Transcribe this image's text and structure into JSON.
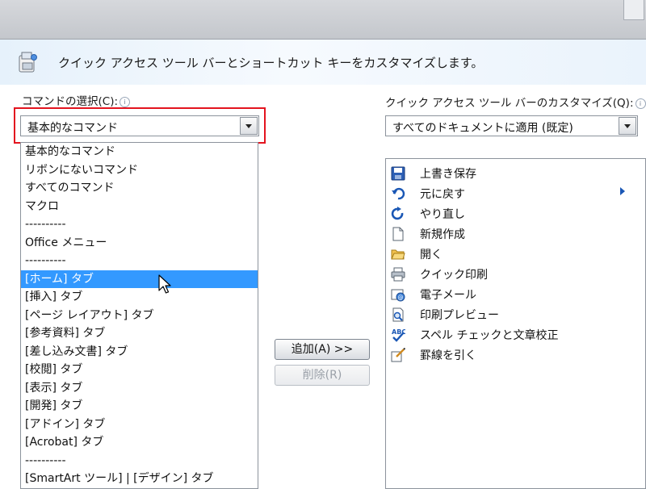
{
  "header": {
    "description": "クイック アクセス ツール バーとショートカット キーをカスタマイズします。"
  },
  "left": {
    "label": "コマンドの選択(C):",
    "selected_value": "基本的なコマンド",
    "options": [
      "基本的なコマンド",
      "リボンにないコマンド",
      "すべてのコマンド",
      "マクロ",
      "----------",
      "Office メニュー",
      "----------",
      "[ホーム] タブ",
      "[挿入] タブ",
      "[ページ レイアウト] タブ",
      "[参考資料] タブ",
      "[差し込み文書] タブ",
      "[校閲] タブ",
      "[表示] タブ",
      "[開発] タブ",
      "[アドイン] タブ",
      "[Acrobat] タブ",
      "----------",
      "[SmartArt ツール] | [デザイン] タブ"
    ],
    "highlighted_option": "[ホーム] タブ"
  },
  "middle": {
    "add_button": "追加(A) >>",
    "remove_button": "削除(R)"
  },
  "right": {
    "label": "クイック アクセス ツール バーのカスタマイズ(Q):",
    "scope_value": "すべてのドキュメントに適用 (既定)",
    "items": [
      {
        "label": "上書き保存",
        "icon": "save-icon"
      },
      {
        "label": "元に戻す",
        "icon": "undo-icon"
      },
      {
        "label": "やり直し",
        "icon": "redo-icon"
      },
      {
        "label": "新規作成",
        "icon": "new-document-icon"
      },
      {
        "label": "開く",
        "icon": "open-folder-icon"
      },
      {
        "label": "クイック印刷",
        "icon": "quick-print-icon"
      },
      {
        "label": "電子メール",
        "icon": "email-icon"
      },
      {
        "label": "印刷プレビュー",
        "icon": "print-preview-icon"
      },
      {
        "label": "スペル チェックと文章校正",
        "icon": "spell-check-icon"
      },
      {
        "label": "罫線を引く",
        "icon": "draw-border-icon"
      }
    ]
  },
  "colors": {
    "highlight_border": "#e3141f",
    "selection": "#3399ff"
  }
}
